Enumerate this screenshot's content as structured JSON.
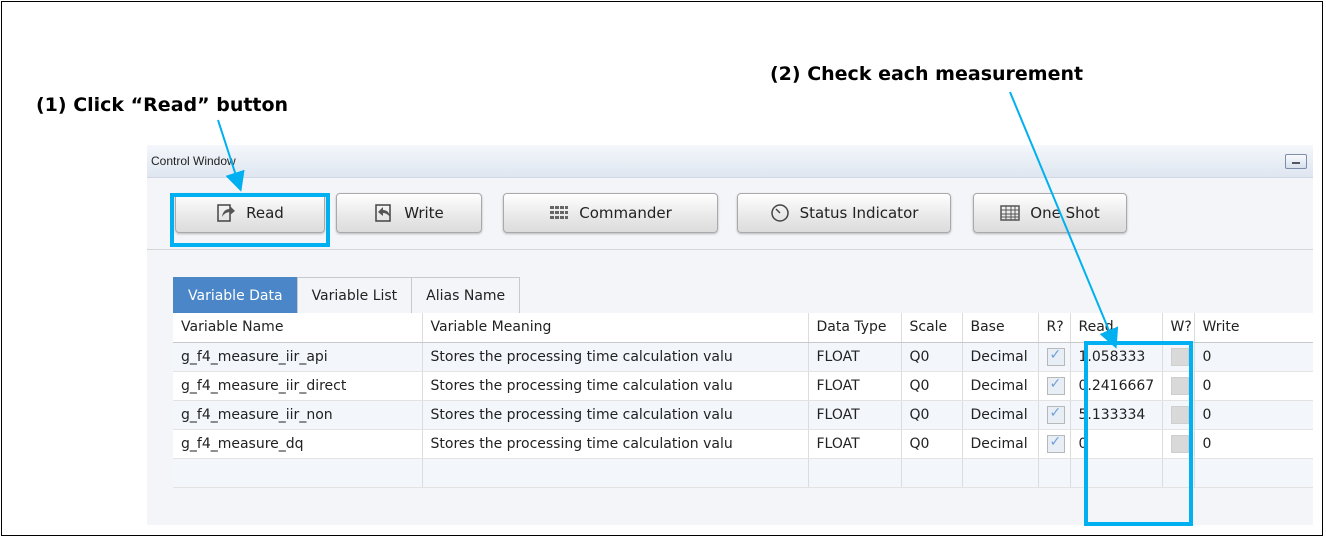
{
  "callouts": {
    "step1": "(1) Click “Read” button",
    "step2": "(2) Check each measurement"
  },
  "window": {
    "title": "Control Window"
  },
  "toolbar": {
    "read": "Read",
    "write": "Write",
    "commander": "Commander",
    "status_indicator": "Status Indicator",
    "one_shot": "One Shot"
  },
  "tabs": [
    "Variable Data",
    "Variable List",
    "Alias Name"
  ],
  "table": {
    "headers": [
      "Variable Name",
      "Variable Meaning",
      "Data Type",
      "Scale",
      "Base",
      "R?",
      "Read",
      "W?",
      "Write"
    ],
    "rows": [
      {
        "name": "g_f4_measure_iir_api",
        "meaning": "Stores the processing time calculation valu",
        "type": "FLOAT",
        "scale": "Q0",
        "base": "Decimal",
        "read": "1.058333",
        "write": "0"
      },
      {
        "name": "g_f4_measure_iir_direct",
        "meaning": "Stores the processing time calculation valu",
        "type": "FLOAT",
        "scale": "Q0",
        "base": "Decimal",
        "read": "0.2416667",
        "write": "0"
      },
      {
        "name": "g_f4_measure_iir_non",
        "meaning": "Stores the processing time calculation valu",
        "type": "FLOAT",
        "scale": "Q0",
        "base": "Decimal",
        "read": "5.133334",
        "write": "0"
      },
      {
        "name": "g_f4_measure_dq",
        "meaning": "Stores the processing time calculation valu",
        "type": "FLOAT",
        "scale": "Q0",
        "base": "Decimal",
        "read": "0",
        "write": "0"
      }
    ]
  },
  "colors": {
    "highlight": "#00b0f0",
    "active_tab": "#4a86c8"
  },
  "icons": {
    "read": "read-arrow-icon",
    "write": "write-arrow-icon",
    "commander": "grid-icon",
    "status": "clock-icon",
    "one_shot": "table-icon"
  }
}
